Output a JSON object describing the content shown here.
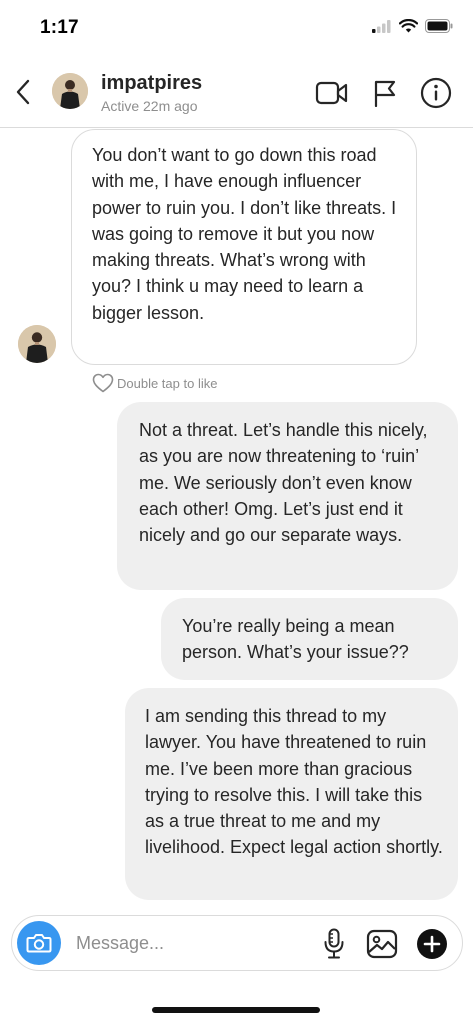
{
  "status_bar": {
    "time": "1:17"
  },
  "header": {
    "username": "impatpires",
    "active_status": "Active 22m ago"
  },
  "messages": [
    {
      "direction": "received",
      "text": "You don’t want to go down this road with me, I have enough influencer power to ruin you.  I don’t like threats.   I was going to remove it but you now making threats.  What’s wrong with you? I think u may need to learn a bigger lesson."
    },
    {
      "direction": "sent",
      "text": "Not a threat. Let’s handle this nicely, as you are now threatening to ‘ruin’ me. We seriously don’t even know each other! Omg. Let’s just end it nicely and go our separate ways."
    },
    {
      "direction": "sent",
      "text": "You’re really being a mean person. What’s your issue??"
    },
    {
      "direction": "sent",
      "text": "I am sending this thread to my lawyer. You have threatened to ruin me. I’ve been more than gracious trying to resolve this. I will take this as a true threat to me and my livelihood. Expect legal action shortly."
    }
  ],
  "like_hint": "Double tap to like",
  "composer": {
    "placeholder": "Message..."
  },
  "colors": {
    "camera_button": "#3897f0",
    "sent_bubble": "#efefef",
    "received_bubble_border": "#dbdbdb",
    "secondary_text": "#8e8e8e"
  },
  "icons": {
    "back": "chevron-left-icon",
    "video_call": "video-camera-icon",
    "report": "flag-icon",
    "info": "info-icon",
    "camera": "camera-icon",
    "microphone": "microphone-icon",
    "gallery": "gallery-icon",
    "add": "plus-circle-icon",
    "like": "heart-icon"
  }
}
